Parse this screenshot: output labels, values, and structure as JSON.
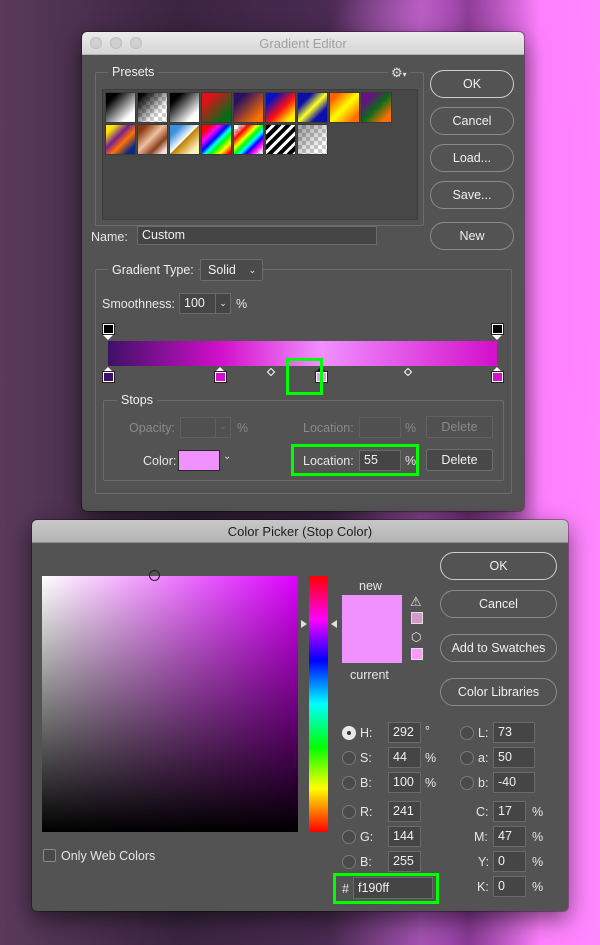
{
  "gradient_editor": {
    "title": "Gradient Editor",
    "presets_label": "Presets",
    "presets_gear_icon": "gear-icon",
    "presets": [
      {
        "name": "foreground-to-background",
        "css": "linear-gradient(135deg,#000 20%,#fff 80%)"
      },
      {
        "name": "foreground-to-transparent",
        "css": "linear-gradient(135deg,#000 10%,rgba(0,0,0,0) 70%)",
        "checker": true
      },
      {
        "name": "black-white",
        "css": "linear-gradient(135deg,#000 20%,#fff 80%)"
      },
      {
        "name": "red-green",
        "css": "linear-gradient(135deg,#e0101a 20%,#0a6a1a 80%)"
      },
      {
        "name": "violet-orange",
        "css": "linear-gradient(135deg,#2a1060 20%,#ff7000 85%)"
      },
      {
        "name": "blue-red-yellow",
        "css": "linear-gradient(135deg,#0a10c0 20%,#ff1010 55%,#ffee00 85%)"
      },
      {
        "name": "blue-yellow-blue",
        "css": "linear-gradient(135deg,#0a10a8 25%,#ffff20 50%,#0a10a8 75%)"
      },
      {
        "name": "orange-yellow-orange",
        "css": "linear-gradient(135deg,#ff6000 15%,#ffff00 50%,#ff7000 85%)"
      },
      {
        "name": "violet-green-orange",
        "css": "linear-gradient(135deg,#6a1080 20%,#0a6a1a 50%,#ff7000 85%)"
      },
      {
        "name": "yellow-violet-orange-blue",
        "css": "linear-gradient(135deg,#ffe600 15%,#7a2090 40%,#ff7000 60%,#0a2a80 85%)"
      },
      {
        "name": "copper",
        "css": "linear-gradient(135deg,#8a3a10 15%,#f0c0a0 45%,#8a4020 70%,#f0e0d8 90%)"
      },
      {
        "name": "chrome",
        "css": "linear-gradient(135deg,#3a90e0 20%,#ffffff 49%,#c08000 51%,#fff0c0 85%)"
      },
      {
        "name": "spectrum",
        "css": "linear-gradient(135deg,#ff0000 15%,#ff00ff 30%,#0000ff 45%,#00ffff 55%,#00ff00 65%,#ffff00 80%,#ff0000 95%)"
      },
      {
        "name": "transparent-rainbow",
        "css": "linear-gradient(135deg,rgba(255,0,0,0) 10%,#ff0000 25%,#ffff00 40%,#00ff00 50%,#00ffff 60%,#0000ff 70%,#ff00ff 80%,rgba(255,0,255,0) 95%)",
        "checker": true
      },
      {
        "name": "transparent-stripes",
        "css": "repeating-linear-gradient(135deg,#000 0 4px,#fff 4px 7px)"
      },
      {
        "name": "neutral-density",
        "css": "linear-gradient(135deg,rgba(0,0,0,0.35) 10%,rgba(0,0,0,0) 80%)",
        "checker": true
      }
    ],
    "buttons": {
      "ok": "OK",
      "cancel": "Cancel",
      "load": "Load...",
      "save": "Save...",
      "new": "New"
    },
    "name_label": "Name:",
    "name_value": "Custom",
    "gradient_type_label": "Gradient Type:",
    "gradient_type_value": "Solid",
    "smoothness_label": "Smoothness:",
    "smoothness_value": "100",
    "smoothness_unit": "%",
    "gradient_bar": {
      "opacity_stops": [
        {
          "location": 0,
          "color": "#000000"
        },
        {
          "location": 100,
          "color": "#000000"
        }
      ],
      "color_stops": [
        {
          "location": 0,
          "color": "#3e1068"
        },
        {
          "location": 29,
          "color": "#d30fca"
        },
        {
          "location": 55,
          "color": "#f190ff",
          "selected": true
        },
        {
          "location": 100,
          "color": "#d30fca"
        }
      ],
      "midpoints": [
        42,
        77
      ]
    },
    "stops": {
      "label": "Stops",
      "opacity_label": "Opacity:",
      "opacity_value": "",
      "opacity_unit": "%",
      "opacity_location_label": "Location:",
      "opacity_location_value": "",
      "opacity_location_unit": "%",
      "opacity_delete": "Delete",
      "color_label": "Color:",
      "color_value": "#f190ff",
      "color_location_label": "Location:",
      "color_location_value": "55",
      "color_location_unit": "%",
      "color_delete": "Delete"
    }
  },
  "color_picker": {
    "title": "Color Picker (Stop Color)",
    "new_label": "new",
    "current_label": "current",
    "new_color": "#f190ff",
    "current_color": "#f190ff",
    "gamut_warning_color": "#d699c9",
    "web_safe_color": "#ff99ff",
    "hue_deg": 292,
    "saturation": 0.44,
    "brightness": 1.0,
    "buttons": {
      "ok": "OK",
      "cancel": "Cancel",
      "add_to_swatches": "Add to Swatches",
      "color_libraries": "Color Libraries"
    },
    "only_web_colors_label": "Only Web Colors",
    "only_web_colors_checked": false,
    "hsb": [
      {
        "label": "H:",
        "value": "292",
        "unit": "°",
        "selected": true
      },
      {
        "label": "S:",
        "value": "44",
        "unit": "%",
        "selected": false
      },
      {
        "label": "B:",
        "value": "100",
        "unit": "%",
        "selected": false
      }
    ],
    "lab": [
      {
        "label": "L:",
        "value": "73"
      },
      {
        "label": "a:",
        "value": "50"
      },
      {
        "label": "b:",
        "value": "-40"
      }
    ],
    "rgb": [
      {
        "label": "R:",
        "value": "241"
      },
      {
        "label": "G:",
        "value": "144"
      },
      {
        "label": "B:",
        "value": "255"
      }
    ],
    "cmyk": [
      {
        "label": "C:",
        "value": "17",
        "unit": "%"
      },
      {
        "label": "M:",
        "value": "47",
        "unit": "%"
      },
      {
        "label": "Y:",
        "value": "0",
        "unit": "%"
      },
      {
        "label": "K:",
        "value": "0",
        "unit": "%"
      }
    ],
    "hex_label": "#",
    "hex_value": "f190ff"
  },
  "highlight_color": "#00ff00"
}
